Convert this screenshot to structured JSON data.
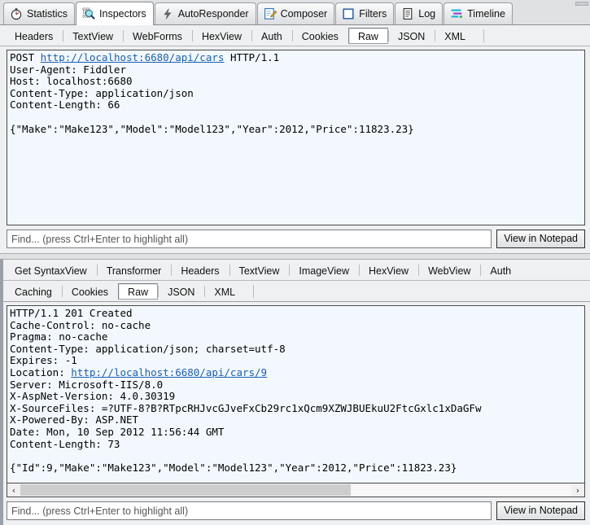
{
  "main_tabs": [
    {
      "label": "Statistics",
      "icon": "stopwatch-icon",
      "selected": false
    },
    {
      "label": "Inspectors",
      "icon": "inspectors-icon",
      "selected": true
    },
    {
      "label": "AutoResponder",
      "icon": "lightning-bolt-icon",
      "selected": false
    },
    {
      "label": "Composer",
      "icon": "notepad-pencil-icon",
      "selected": false
    },
    {
      "label": "Filters",
      "icon": "blue-square-icon",
      "selected": false
    },
    {
      "label": "Log",
      "icon": "document-icon",
      "selected": false
    },
    {
      "label": "Timeline",
      "icon": "timeline-bars-icon",
      "selected": false
    }
  ],
  "request": {
    "tabs": [
      {
        "label": "Headers",
        "selected": false
      },
      {
        "label": "TextView",
        "selected": false
      },
      {
        "label": "WebForms",
        "selected": false
      },
      {
        "label": "HexView",
        "selected": false
      },
      {
        "label": "Auth",
        "selected": false
      },
      {
        "label": "Cookies",
        "selected": false
      },
      {
        "label": "Raw",
        "selected": true
      },
      {
        "label": "JSON",
        "selected": false
      },
      {
        "label": "XML",
        "selected": false
      }
    ],
    "raw": {
      "request_line_method": "POST ",
      "request_line_url": "http://localhost:6680/api/cars",
      "request_line_version": " HTTP/1.1",
      "headers_and_body": "User-Agent: Fiddler\nHost: localhost:6680\nContent-Type: application/json\nContent-Length: 66\n\n{\"Make\":\"Make123\",\"Model\":\"Model123\",\"Year\":2012,\"Price\":11823.23}"
    },
    "find": {
      "placeholder": "Find... (press Ctrl+Enter to highlight all)",
      "value": ""
    },
    "notepad_button": "View in Notepad"
  },
  "response": {
    "tabs_row1": [
      {
        "label": "Get SyntaxView",
        "selected": false
      },
      {
        "label": "Transformer",
        "selected": false
      },
      {
        "label": "Headers",
        "selected": false
      },
      {
        "label": "TextView",
        "selected": false
      },
      {
        "label": "ImageView",
        "selected": false
      },
      {
        "label": "HexView",
        "selected": false
      },
      {
        "label": "WebView",
        "selected": false
      },
      {
        "label": "Auth",
        "selected": false
      }
    ],
    "tabs_row2": [
      {
        "label": "Caching",
        "selected": false
      },
      {
        "label": "Cookies",
        "selected": false
      },
      {
        "label": "Raw",
        "selected": true
      },
      {
        "label": "JSON",
        "selected": false
      },
      {
        "label": "XML",
        "selected": false
      }
    ],
    "raw": {
      "head": "HTTP/1.1 201 Created\nCache-Control: no-cache\nPragma: no-cache\nContent-Type: application/json; charset=utf-8\nExpires: -1\nLocation: ",
      "location_url": "http://localhost:6680/api/cars/9",
      "tail": "\nServer: Microsoft-IIS/8.0\nX-AspNet-Version: 4.0.30319\nX-SourceFiles: =?UTF-8?B?RTpcRHJvcGJveFxCb29rc1xQcm9XZWJBUEkuU2FtcGxlc1xDaGFw\nX-Powered-By: ASP.NET\nDate: Mon, 10 Sep 2012 11:56:44 GMT\nContent-Length: 73\n\n{\"Id\":9,\"Make\":\"Make123\",\"Model\":\"Model123\",\"Year\":2012,\"Price\":11823.23}"
    },
    "scrollbar": {
      "left_arrow": "‹",
      "right_arrow": "›"
    },
    "find": {
      "placeholder": "Find... (press Ctrl+Enter to highlight all)",
      "value": ""
    },
    "notepad_button": "View in Notepad"
  },
  "colors": {
    "viewer_background": "#f2f8fd",
    "link": "#1a5fb4",
    "tab_strip": "#dfe1e3",
    "chrome": "#eff0f1"
  }
}
